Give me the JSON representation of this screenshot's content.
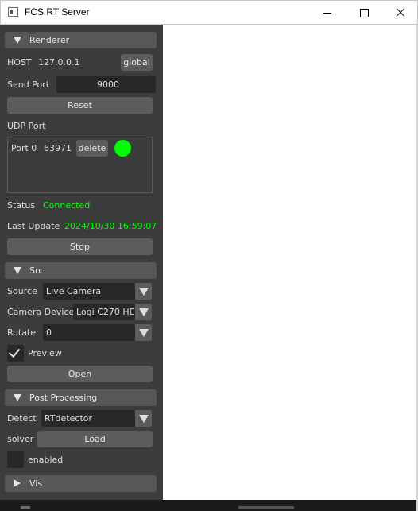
{
  "window": {
    "title": "FCS RT Server"
  },
  "renderer": {
    "header": "Renderer",
    "host_label": "HOST",
    "host_value": "127.0.0.1",
    "global_button": "global",
    "send_port_label": "Send Port",
    "send_port_value": "9000",
    "reset_button": "Reset",
    "udp_port_label": "UDP Port",
    "ports": [
      {
        "name": "Port 0",
        "value": "63971",
        "delete_label": "delete",
        "status_color": "#00ff00"
      }
    ],
    "status_label": "Status",
    "status_value": "Connected",
    "last_update_label": "Last Update",
    "last_update_value": "2024/10/30 16:59:07",
    "stop_button": "Stop"
  },
  "src": {
    "header": "Src",
    "source_label": "Source",
    "source_value": "Live Camera",
    "camera_device_label": "Camera Device",
    "camera_device_value": "Logi C270 HD",
    "rotate_label": "Rotate",
    "rotate_value": "0",
    "preview_label": "Preview",
    "preview_checked": true,
    "open_button": "Open"
  },
  "post_processing": {
    "header": "Post Processing",
    "detect_label": "Detect",
    "detect_value": "RTdetector",
    "solver_label": "solver",
    "load_button": "Load",
    "enabled_label": "enabled",
    "enabled_checked": false
  },
  "vis": {
    "header": "Vis"
  },
  "colors": {
    "accent_green": "#00ff00",
    "panel_bg": "#3c3c3c",
    "header_bg": "#575757",
    "button_bg": "#5c5c5c",
    "field_bg": "#282828"
  }
}
